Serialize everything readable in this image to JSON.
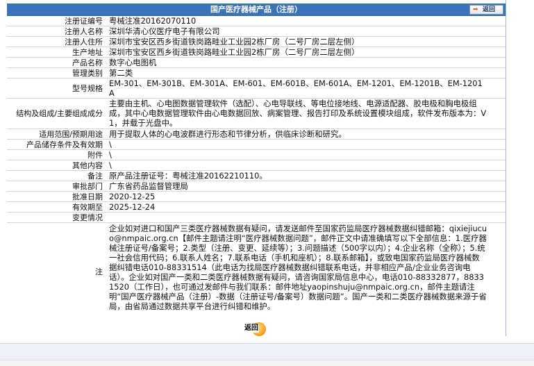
{
  "header": {
    "title": "国产医疗器械产品（注册）",
    "back_label": "返回"
  },
  "fields": [
    {
      "label": "注册证编号",
      "value": "粤械注准20162070110"
    },
    {
      "label": "注册人名称",
      "value": "深圳华清心仪医疗电子有限公司"
    },
    {
      "label": "注册人住所",
      "value": "深圳市宝安区西乡街道铁岗路畦业工业园2栋厂房（二号厂房二层左侧）"
    },
    {
      "label": "生产地址",
      "value": "深圳市宝安区西乡街道铁岗路畦业工业园2栋厂房（二号厂房二层左侧）"
    },
    {
      "label": "产品名称",
      "value": "数字心电图机"
    },
    {
      "label": "管理类别",
      "value": "第二类"
    },
    {
      "label": "型号规格",
      "value": "EM-301、EM-301B、EM-301A、EM-601、EM-601B、EM-601A、EM-1201、EM-1201B、EM-1201A"
    },
    {
      "label": "结构及组成/主要组成成分",
      "value": "主要由主机、心电图数据管理软件（选配）、心电导联线、等电位接地线、电源适配器、胶电极和胸电极组成，其中心电数据管理软件由心电数据回放、病案管理、报告打印及系统设置模块组成，软件发布版本为：V1，并载于光盘中。"
    },
    {
      "label": "适用范围/预期用途",
      "value": "用于提取人体的心电波群进行形态和节律分析，供临床诊断和研究。"
    },
    {
      "label": "产品储存条件及有效期",
      "value": "\\"
    },
    {
      "label": "附件",
      "value": "\\"
    },
    {
      "label": "其他内容",
      "value": "\\"
    },
    {
      "label": "备注",
      "value": "原产品注册证号：粤械注准20162210110。"
    },
    {
      "label": "审批部门",
      "value": "广东省药品监督管理局"
    },
    {
      "label": "批准日期",
      "value": "2020-12-25"
    },
    {
      "label": "有效期至",
      "value": "2025-12-24"
    },
    {
      "label": "变更情况",
      "value": ""
    },
    {
      "label": "注",
      "value": "企业如对进口和国产三类医疗器械数据有疑问，请发送邮件至国家药监局医疗器械数据纠错邮箱：qixiejiucuo@nmpaic.org.cn【邮件主题请注明“医疗器械数据问题”，邮件正文中请准确填写以下全部信息：1.医疗器械注册证号/备案号；2.类型（注册、变更、延续等）；3.问题描述（500字以内）；4.企业名称（全称）；5.统一社会信用代码；6.联系人姓名；7.联系电话（手机和座机）；8.联系邮箱】，或致电国家药监局医疗器械数据纠错电话010-88331514（此电话为找局医疗器械数据纠错联系电话，并非相应产品/企业业务咨询电话）。企业如对国产一类和二类医疗器械数据有疑问，请咨询国家局信息中心，电话010-88332877，88331520（工作日），也可通过发邮件与我们联系：邮件地址yaopinshuju@nmpaic.org.cn，邮件主题请注明“国产医疗器械产品（注册）-数据（注册证号/备案号）数据问题”。国产一类和二类医疗器械数据来源于省局，由省局通过数据共享平台进行纠错和维护。"
    }
  ],
  "footer": {
    "back_label": "返回"
  },
  "colors": {
    "title_bar": "#3a73b7",
    "row_divider": "#d6d6d6",
    "button_orange": "#f5a623"
  }
}
